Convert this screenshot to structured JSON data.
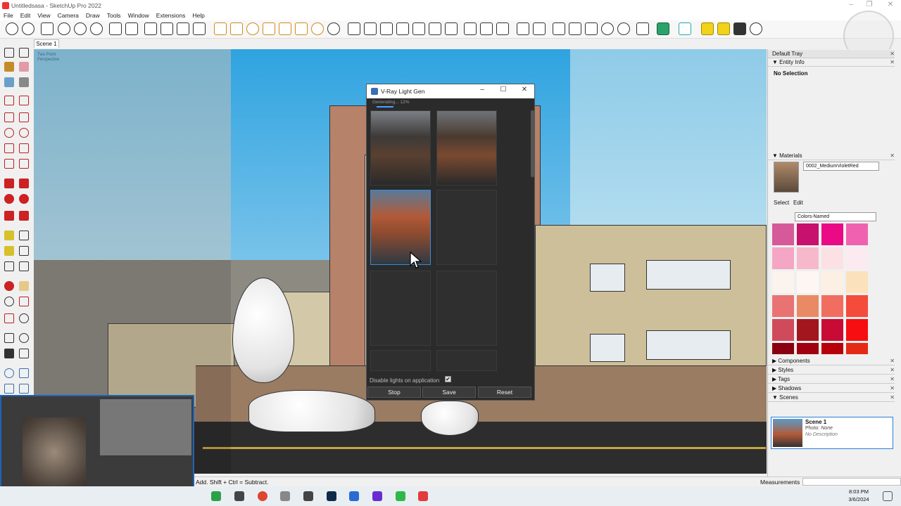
{
  "window": {
    "title": "Untitledsasa - SketchUp Pro 2022"
  },
  "menu": [
    "File",
    "Edit",
    "View",
    "Camera",
    "Draw",
    "Tools",
    "Window",
    "Extensions",
    "Help"
  ],
  "scene_tab": "Scene 1",
  "viewport": {
    "perspective_label": "Two Point\nPerspective"
  },
  "dialog": {
    "title": "V-Ray Light Gen",
    "status": "Generating... 12%",
    "progress_percent": 12,
    "disable_label": "Disable lights on application",
    "disable_checked": true,
    "checkmark": "✔",
    "buttons": {
      "stop": "Stop",
      "save": "Save",
      "reset": "Reset"
    }
  },
  "tray": {
    "title": "Default Tray",
    "entity_info": {
      "header": "Entity Info",
      "value": "No Selection"
    },
    "materials": {
      "header": "Materials",
      "current": "0002_MediumVioletRed",
      "tabs": {
        "select": "Select",
        "edit": "Edit"
      },
      "collection": "Colors-Named",
      "swatches": [
        "#d65a9a",
        "#c8106e",
        "#ea0a86",
        "#f062b0",
        "#f4a6c4",
        "#f7b8cc",
        "#fbe0e4",
        "#fbeaf0",
        "#fbf3ee",
        "#fdf6f2",
        "#fcefe4",
        "#fce2bc",
        "#e97273",
        "#ea8a65",
        "#f16d5f",
        "#f44b3a",
        "#cf4b5c",
        "#a3161e",
        "#c80a35",
        "#f70e10",
        "#8a0010",
        "#a0000f",
        "#b8000b",
        "#e42a14"
      ]
    },
    "panels": [
      "Components",
      "Styles",
      "Tags",
      "Shadows",
      "Scenes"
    ],
    "scene": {
      "name": "Scene 1",
      "photo_label": "Photo:",
      "photo_value": "None",
      "description": "No Description"
    }
  },
  "status_bar": {
    "hint": "Add. Shift + Ctrl = Subtract.",
    "measurements_label": "Measurements"
  },
  "taskbar": {
    "time": "8:03 PM",
    "date": "3/6/2024"
  },
  "icons": [
    "sketchup-app-icon",
    "vray-icon",
    "search-icon",
    "close-icon",
    "minimize-icon",
    "maximize-icon",
    "cursor-arrow-icon",
    "checkbox-icon"
  ]
}
